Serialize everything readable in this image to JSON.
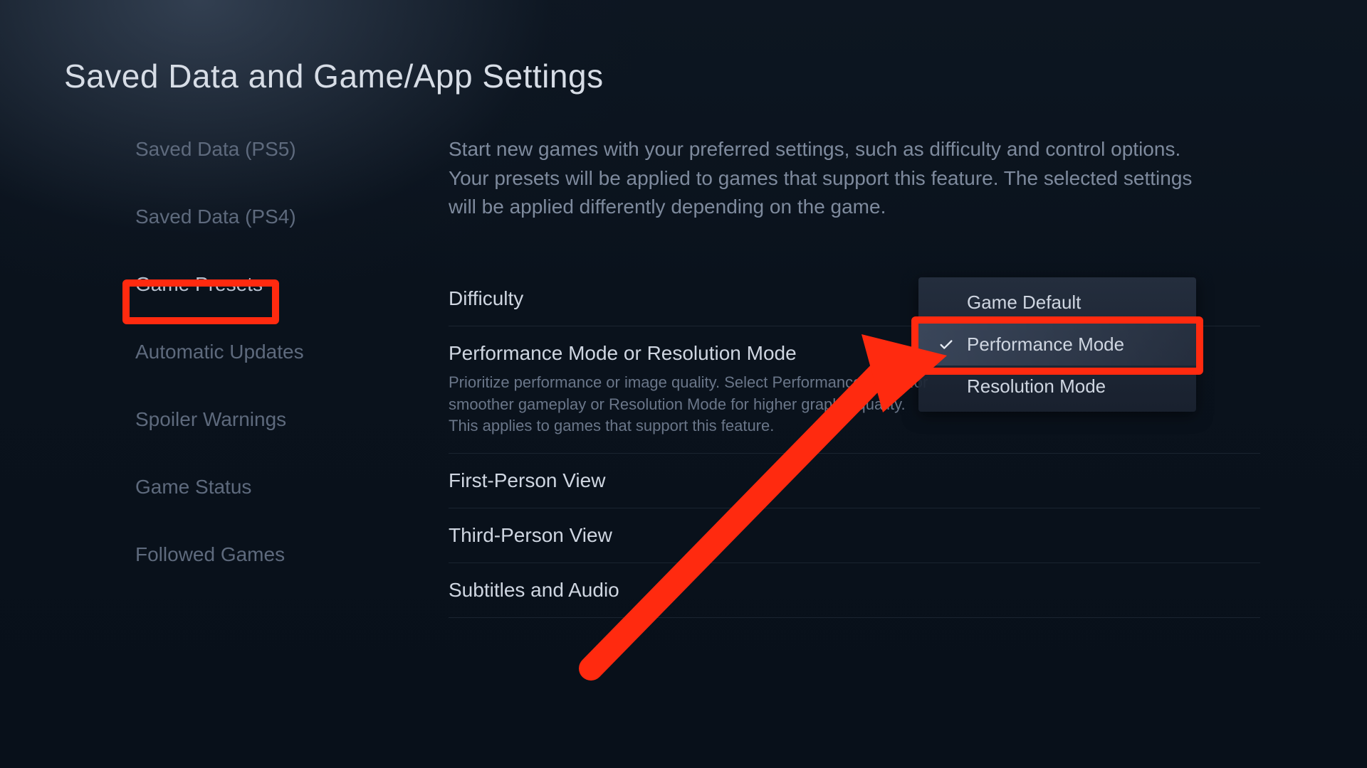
{
  "title": "Saved Data and Game/App Settings",
  "sidebar": {
    "items": [
      {
        "label": "Saved Data (PS5)"
      },
      {
        "label": "Saved Data (PS4)"
      },
      {
        "label": "Game Presets",
        "selected": true
      },
      {
        "label": "Automatic Updates"
      },
      {
        "label": "Spoiler Warnings"
      },
      {
        "label": "Game Status"
      },
      {
        "label": "Followed Games"
      }
    ]
  },
  "content": {
    "description": "Start new games with your preferred settings, such as difficulty and control options. Your presets will be applied to games that support this feature. The selected settings will be applied differently depending on the game.",
    "rows": [
      {
        "title": "Difficulty"
      },
      {
        "title": "Performance Mode or Resolution Mode",
        "description": "Prioritize performance or image quality. Select Performance Mode for smoother gameplay or Resolution Mode for higher graphic quality. This applies to games that support this feature."
      },
      {
        "title": "First-Person View"
      },
      {
        "title": "Third-Person View"
      },
      {
        "title": "Subtitles and Audio"
      }
    ]
  },
  "dropdown": {
    "options": [
      {
        "label": "Game Default"
      },
      {
        "label": "Performance Mode",
        "selected": true
      },
      {
        "label": "Resolution Mode"
      }
    ]
  },
  "annotations": {
    "highlight_color": "#ff2a0f"
  }
}
